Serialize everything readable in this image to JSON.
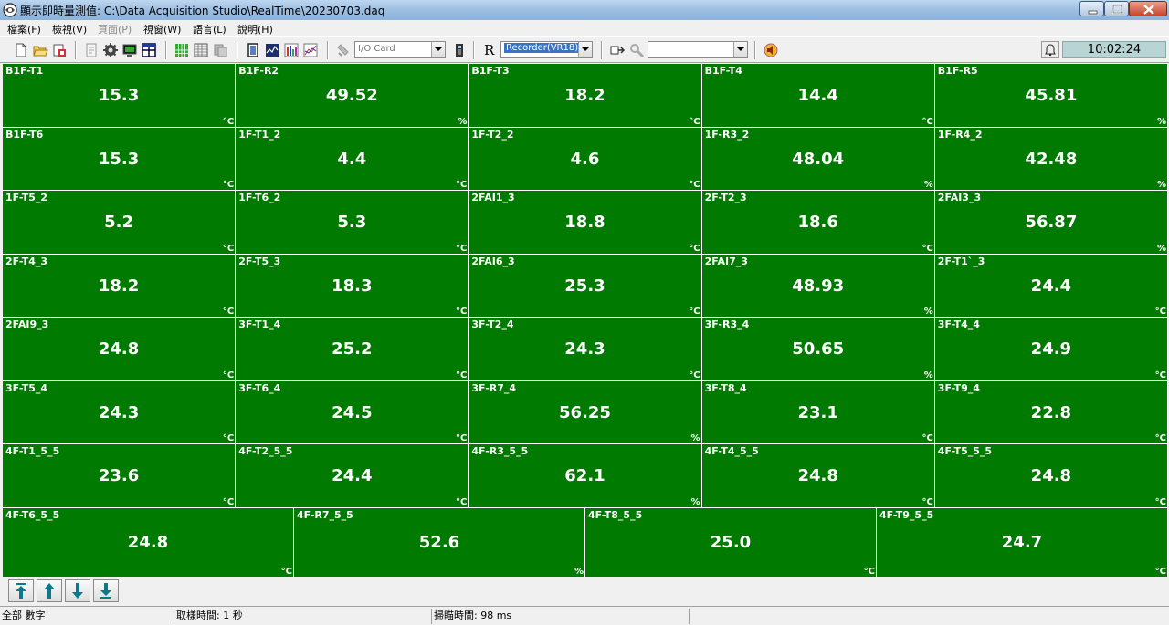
{
  "window": {
    "title": "顯示即時量測值: C:\\Data Acquisition Studio\\RealTime\\20230703.daq"
  },
  "menu": [
    {
      "label": "檔案(F)",
      "enabled": true
    },
    {
      "label": "檢視(V)",
      "enabled": true
    },
    {
      "label": "頁面(P)",
      "enabled": false
    },
    {
      "label": "視窗(W)",
      "enabled": true
    },
    {
      "label": "語言(L)",
      "enabled": true
    },
    {
      "label": "說明(H)",
      "enabled": true
    }
  ],
  "toolbar": {
    "io_card_value": "I/O Card",
    "r_label": "R",
    "recorder_value": "Recorder(VR18)",
    "third_combo_value": "",
    "clock": "10:02:24"
  },
  "tiles": [
    {
      "name": "B1F-T1",
      "value": "15.3",
      "unit": "°C"
    },
    {
      "name": "B1F-R2",
      "value": "49.52",
      "unit": "%"
    },
    {
      "name": "B1F-T3",
      "value": "18.2",
      "unit": "°C"
    },
    {
      "name": "B1F-T4",
      "value": "14.4",
      "unit": "°C"
    },
    {
      "name": "B1F-R5",
      "value": "45.81",
      "unit": "%"
    },
    {
      "name": "B1F-T6",
      "value": "15.3",
      "unit": "°C"
    },
    {
      "name": "1F-T1_2",
      "value": "4.4",
      "unit": "°C"
    },
    {
      "name": "1F-T2_2",
      "value": "4.6",
      "unit": "°C"
    },
    {
      "name": "1F-R3_2",
      "value": "48.04",
      "unit": "%"
    },
    {
      "name": "1F-R4_2",
      "value": "42.48",
      "unit": "%"
    },
    {
      "name": "1F-T5_2",
      "value": "5.2",
      "unit": "°C"
    },
    {
      "name": "1F-T6_2",
      "value": "5.3",
      "unit": "°C"
    },
    {
      "name": "2FAI1_3",
      "value": "18.8",
      "unit": "°C"
    },
    {
      "name": "2F-T2_3",
      "value": "18.6",
      "unit": "°C"
    },
    {
      "name": "2FAI3_3",
      "value": "56.87",
      "unit": "%"
    },
    {
      "name": "2F-T4_3",
      "value": "18.2",
      "unit": "°C"
    },
    {
      "name": "2F-T5_3",
      "value": "18.3",
      "unit": "°C"
    },
    {
      "name": "2FAI6_3",
      "value": "25.3",
      "unit": "°C"
    },
    {
      "name": "2FAI7_3",
      "value": "48.93",
      "unit": "%"
    },
    {
      "name": "2F-T1`_3",
      "value": "24.4",
      "unit": "°C"
    },
    {
      "name": "2FAI9_3",
      "value": "24.8",
      "unit": "°C"
    },
    {
      "name": "3F-T1_4",
      "value": "25.2",
      "unit": "°C"
    },
    {
      "name": "3F-T2_4",
      "value": "24.3",
      "unit": "°C"
    },
    {
      "name": "3F-R3_4",
      "value": "50.65",
      "unit": "%"
    },
    {
      "name": "3F-T4_4",
      "value": "24.9",
      "unit": "°C"
    },
    {
      "name": "3F-T5_4",
      "value": "24.3",
      "unit": "°C"
    },
    {
      "name": "3F-T6_4",
      "value": "24.5",
      "unit": "°C"
    },
    {
      "name": "3F-R7_4",
      "value": "56.25",
      "unit": "%"
    },
    {
      "name": "3F-T8_4",
      "value": "23.1",
      "unit": "°C"
    },
    {
      "name": "3F-T9_4",
      "value": "22.8",
      "unit": "°C"
    },
    {
      "name": "4F-T1_5_5",
      "value": "23.6",
      "unit": "°C"
    },
    {
      "name": "4F-T2_5_5",
      "value": "24.4",
      "unit": "°C"
    },
    {
      "name": "4F-R3_5_5",
      "value": "62.1",
      "unit": "%"
    },
    {
      "name": "4F-T4_5_5",
      "value": "24.8",
      "unit": "°C"
    },
    {
      "name": "4F-T5_5_5",
      "value": "24.8",
      "unit": "°C"
    },
    {
      "name": "4F-T6_5_5",
      "value": "24.8",
      "unit": "°C"
    },
    {
      "name": "4F-R7_5_5",
      "value": "52.6",
      "unit": "%"
    },
    {
      "name": "4F-T8_5_5",
      "value": "25.0",
      "unit": "°C"
    },
    {
      "name": "4F-T9_5_5",
      "value": "24.7",
      "unit": "°C"
    }
  ],
  "nav_buttons": [
    "first-page-icon",
    "prev-page-icon",
    "next-page-icon",
    "last-page-icon"
  ],
  "status": {
    "mode": "全部 數字",
    "sampling": "取樣時間: 1 秒",
    "scan": "掃瞄時間: 98 ms"
  },
  "colors": {
    "tile_bg": "#007a00",
    "tile_text": "#ffffff",
    "clock_bg": "#b8d4d4",
    "selection": "#3a74c4"
  }
}
